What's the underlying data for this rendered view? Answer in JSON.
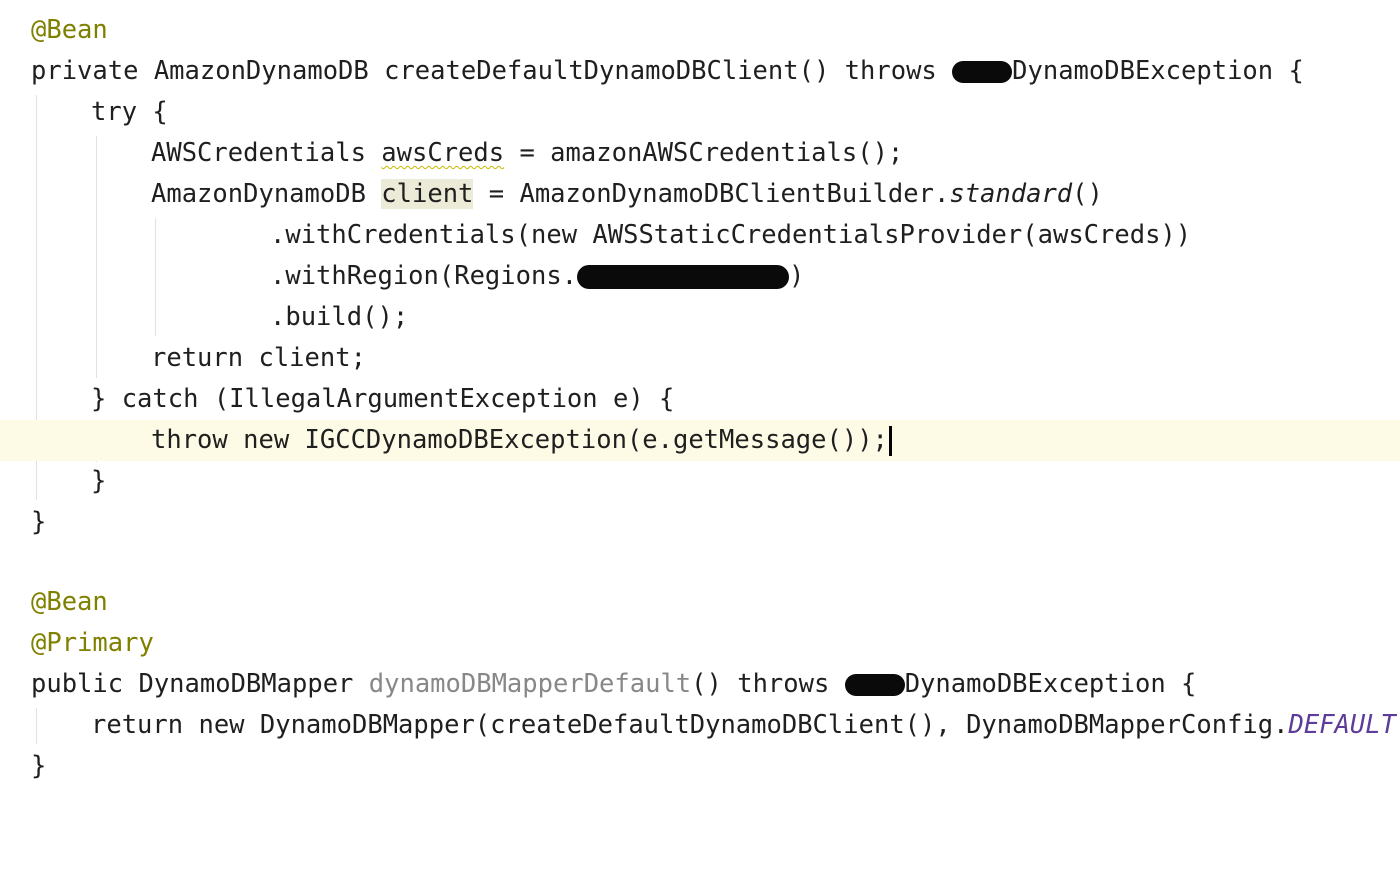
{
  "editor": {
    "colors": {
      "current_line_bg": "#fdfbe6",
      "annotation": "#808000",
      "unused_symbol": "#888888",
      "constant": "#5e3c99",
      "highlight_bg": "#ecebd8",
      "redaction": "#0a0a0a"
    },
    "lines": {
      "l1": "@Bean",
      "l2": {
        "a": "private AmazonDynamoDB createDefaultDynamoDBClient() throws ",
        "b": "DynamoDBException {"
      },
      "l3": "try {",
      "l4": {
        "a": "AWSCredentials ",
        "var": "awsCreds",
        "b": " = amazonAWSCredentials();"
      },
      "l5": {
        "a": "AmazonDynamoDB ",
        "var": "client",
        "b": " = AmazonDynamoDBClientBuilder.",
        "method": "standard",
        "c": "()"
      },
      "l6": ".withCredentials(new AWSStaticCredentialsProvider(awsCreds))",
      "l7": {
        "a": ".withRegion(Regions.",
        "b": ")"
      },
      "l8": ".build();",
      "l9": "return client;",
      "l10": "} catch (IllegalArgumentException e) {",
      "l11": "throw new IGCCDynamoDBException(e.getMessage());",
      "l12": "}",
      "l13": "}",
      "l14": "@Bean",
      "l15": "@Primary",
      "l16": {
        "a": "public DynamoDBMapper ",
        "name": "dynamoDBMapperDefault",
        "b": "() throws ",
        "c": "DynamoDBException {"
      },
      "l17": {
        "a": "return new DynamoDBMapper(createDefaultDynamoDBClient(), DynamoDBMapperConfig.",
        "const": "DEFAULT",
        "b": ");"
      },
      "l18": "}"
    }
  }
}
